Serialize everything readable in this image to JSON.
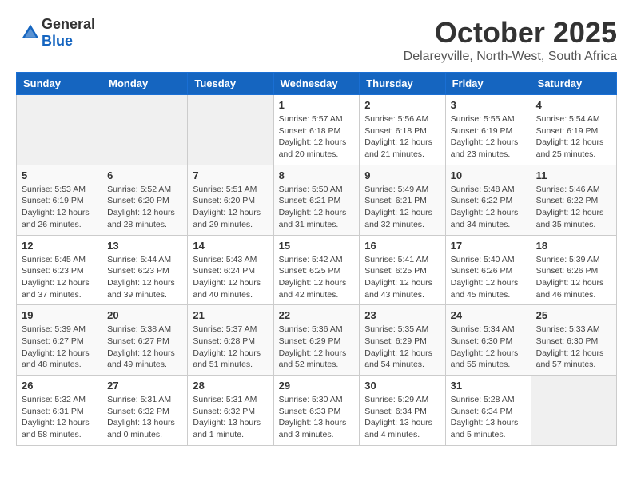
{
  "header": {
    "logo_general": "General",
    "logo_blue": "Blue",
    "month": "October 2025",
    "location": "Delareyville, North-West, South Africa"
  },
  "weekdays": [
    "Sunday",
    "Monday",
    "Tuesday",
    "Wednesday",
    "Thursday",
    "Friday",
    "Saturday"
  ],
  "weeks": [
    [
      {
        "day": "",
        "info": ""
      },
      {
        "day": "",
        "info": ""
      },
      {
        "day": "",
        "info": ""
      },
      {
        "day": "1",
        "info": "Sunrise: 5:57 AM\nSunset: 6:18 PM\nDaylight: 12 hours\nand 20 minutes."
      },
      {
        "day": "2",
        "info": "Sunrise: 5:56 AM\nSunset: 6:18 PM\nDaylight: 12 hours\nand 21 minutes."
      },
      {
        "day": "3",
        "info": "Sunrise: 5:55 AM\nSunset: 6:19 PM\nDaylight: 12 hours\nand 23 minutes."
      },
      {
        "day": "4",
        "info": "Sunrise: 5:54 AM\nSunset: 6:19 PM\nDaylight: 12 hours\nand 25 minutes."
      }
    ],
    [
      {
        "day": "5",
        "info": "Sunrise: 5:53 AM\nSunset: 6:19 PM\nDaylight: 12 hours\nand 26 minutes."
      },
      {
        "day": "6",
        "info": "Sunrise: 5:52 AM\nSunset: 6:20 PM\nDaylight: 12 hours\nand 28 minutes."
      },
      {
        "day": "7",
        "info": "Sunrise: 5:51 AM\nSunset: 6:20 PM\nDaylight: 12 hours\nand 29 minutes."
      },
      {
        "day": "8",
        "info": "Sunrise: 5:50 AM\nSunset: 6:21 PM\nDaylight: 12 hours\nand 31 minutes."
      },
      {
        "day": "9",
        "info": "Sunrise: 5:49 AM\nSunset: 6:21 PM\nDaylight: 12 hours\nand 32 minutes."
      },
      {
        "day": "10",
        "info": "Sunrise: 5:48 AM\nSunset: 6:22 PM\nDaylight: 12 hours\nand 34 minutes."
      },
      {
        "day": "11",
        "info": "Sunrise: 5:46 AM\nSunset: 6:22 PM\nDaylight: 12 hours\nand 35 minutes."
      }
    ],
    [
      {
        "day": "12",
        "info": "Sunrise: 5:45 AM\nSunset: 6:23 PM\nDaylight: 12 hours\nand 37 minutes."
      },
      {
        "day": "13",
        "info": "Sunrise: 5:44 AM\nSunset: 6:23 PM\nDaylight: 12 hours\nand 39 minutes."
      },
      {
        "day": "14",
        "info": "Sunrise: 5:43 AM\nSunset: 6:24 PM\nDaylight: 12 hours\nand 40 minutes."
      },
      {
        "day": "15",
        "info": "Sunrise: 5:42 AM\nSunset: 6:25 PM\nDaylight: 12 hours\nand 42 minutes."
      },
      {
        "day": "16",
        "info": "Sunrise: 5:41 AM\nSunset: 6:25 PM\nDaylight: 12 hours\nand 43 minutes."
      },
      {
        "day": "17",
        "info": "Sunrise: 5:40 AM\nSunset: 6:26 PM\nDaylight: 12 hours\nand 45 minutes."
      },
      {
        "day": "18",
        "info": "Sunrise: 5:39 AM\nSunset: 6:26 PM\nDaylight: 12 hours\nand 46 minutes."
      }
    ],
    [
      {
        "day": "19",
        "info": "Sunrise: 5:39 AM\nSunset: 6:27 PM\nDaylight: 12 hours\nand 48 minutes."
      },
      {
        "day": "20",
        "info": "Sunrise: 5:38 AM\nSunset: 6:27 PM\nDaylight: 12 hours\nand 49 minutes."
      },
      {
        "day": "21",
        "info": "Sunrise: 5:37 AM\nSunset: 6:28 PM\nDaylight: 12 hours\nand 51 minutes."
      },
      {
        "day": "22",
        "info": "Sunrise: 5:36 AM\nSunset: 6:29 PM\nDaylight: 12 hours\nand 52 minutes."
      },
      {
        "day": "23",
        "info": "Sunrise: 5:35 AM\nSunset: 6:29 PM\nDaylight: 12 hours\nand 54 minutes."
      },
      {
        "day": "24",
        "info": "Sunrise: 5:34 AM\nSunset: 6:30 PM\nDaylight: 12 hours\nand 55 minutes."
      },
      {
        "day": "25",
        "info": "Sunrise: 5:33 AM\nSunset: 6:30 PM\nDaylight: 12 hours\nand 57 minutes."
      }
    ],
    [
      {
        "day": "26",
        "info": "Sunrise: 5:32 AM\nSunset: 6:31 PM\nDaylight: 12 hours\nand 58 minutes."
      },
      {
        "day": "27",
        "info": "Sunrise: 5:31 AM\nSunset: 6:32 PM\nDaylight: 13 hours\nand 0 minutes."
      },
      {
        "day": "28",
        "info": "Sunrise: 5:31 AM\nSunset: 6:32 PM\nDaylight: 13 hours\nand 1 minute."
      },
      {
        "day": "29",
        "info": "Sunrise: 5:30 AM\nSunset: 6:33 PM\nDaylight: 13 hours\nand 3 minutes."
      },
      {
        "day": "30",
        "info": "Sunrise: 5:29 AM\nSunset: 6:34 PM\nDaylight: 13 hours\nand 4 minutes."
      },
      {
        "day": "31",
        "info": "Sunrise: 5:28 AM\nSunset: 6:34 PM\nDaylight: 13 hours\nand 5 minutes."
      },
      {
        "day": "",
        "info": ""
      }
    ]
  ]
}
